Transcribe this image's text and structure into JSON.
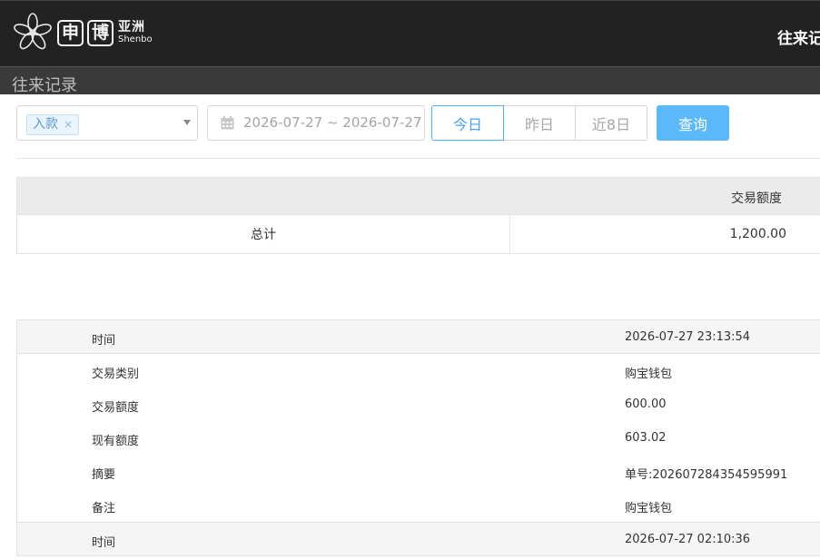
{
  "header": {
    "logo": {
      "box1": "申",
      "box2": "博",
      "cn": "亚洲",
      "en": "Shenbo"
    },
    "title": "往来记"
  },
  "subheader": {
    "title": "往来记录"
  },
  "filters": {
    "type_tag": "入款",
    "tag_remove": "×",
    "date_range": "2026-07-27 ~ 2026-07-27",
    "quick_buttons": [
      {
        "label": "今日",
        "active": true
      },
      {
        "label": "昨日",
        "active": false
      },
      {
        "label": "近8日",
        "active": false
      }
    ],
    "query_label": "查询"
  },
  "summary": {
    "column_label": "交易额度",
    "total_label": "总计",
    "total_amount": "1,200.00"
  },
  "records": [
    {
      "time_label": "时间",
      "time": "2026-07-27 23:13:54",
      "fields": [
        {
          "label": "交易类别",
          "value": "购宝钱包"
        },
        {
          "label": "交易额度",
          "value": "600.00"
        },
        {
          "label": "现有额度",
          "value": "603.02"
        },
        {
          "label": "摘要",
          "value": "单号:202607284354595991"
        },
        {
          "label": "备注",
          "value": "购宝钱包"
        }
      ]
    },
    {
      "time_label": "时间",
      "time": "2026-07-27 02:10:36",
      "fields": []
    }
  ],
  "colors": {
    "accent": "#5bb8f9",
    "topbar": "#222222",
    "subbar": "#3a3a3a"
  }
}
